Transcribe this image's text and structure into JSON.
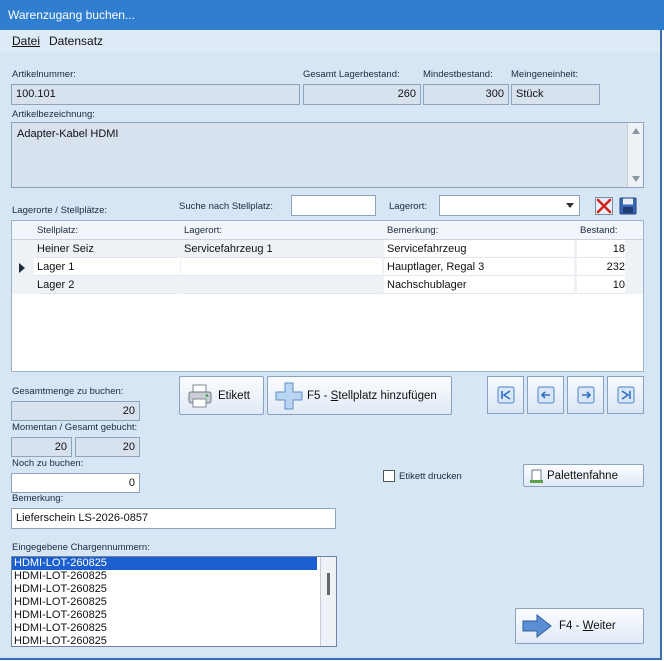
{
  "window": {
    "title": "Warenzugang buchen..."
  },
  "menu": {
    "file": "Datei",
    "record": "Datensatz"
  },
  "article": {
    "number_label": "Artikelnummer:",
    "number": "100.101",
    "total_stock_label": "Gesamt Lagerbestand:",
    "total_stock": "260",
    "min_stock_label": "Mindestbestand:",
    "min_stock": "300",
    "unit_label": "Meingeneinheit:",
    "unit": "Stück",
    "desc_label": "Artikelbezeichnung:",
    "desc": "Adapter-Kabel HDMI"
  },
  "locations": {
    "label": "Lagerorte / Stellplätze:",
    "search_label": "Suche nach Stellplatz:",
    "search_value": "",
    "lagerort_label": "Lagerort:",
    "lagerort_value": "",
    "columns": [
      "Stellplatz:",
      "Lagerort:",
      "Bemerkung:",
      "Bestand:"
    ],
    "rows": [
      {
        "stellplatz": "Heiner Seiz",
        "lagerort": "Servicefahrzeug 1",
        "bemerkung": "Servicefahrzeug",
        "bestand": "18"
      },
      {
        "stellplatz": "Lager 1",
        "lagerort": "",
        "bemerkung": "Hauptlager, Regal 3",
        "bestand": "232"
      },
      {
        "stellplatz": "Lager 2",
        "lagerort": "",
        "bemerkung": "Nachschublager",
        "bestand": "10"
      }
    ],
    "current_row_marker": "▶"
  },
  "booking": {
    "total_label": "Gesamtmenge zu buchen:",
    "total": "20",
    "current_label": "Momentan / Gesamt gebucht:",
    "current": "20",
    "overall": "20",
    "remaining_label": "Noch zu buchen:",
    "remaining": "0",
    "remark_label": "Bemerkung:",
    "remark": "Lieferschein LS-2026-0857",
    "print_label_checkbox": "Etikett drucken",
    "print_label_checked": false
  },
  "buttons": {
    "label_btn": "Etikett",
    "add_slot_prefix": "F5 - ",
    "add_slot_hot": "S",
    "add_slot_rest": "tellplatz hinzufügen",
    "pallet": "Palettenfahne",
    "next_prefix": "F4 - ",
    "next_hot": "W",
    "next_rest": "eiter"
  },
  "batches": {
    "label": "Eingegebene Chargennummern:",
    "items": [
      "HDMI-LOT-260825",
      "HDMI-LOT-260825",
      "HDMI-LOT-260825",
      "HDMI-LOT-260825",
      "HDMI-LOT-260825",
      "HDMI-LOT-260825",
      "HDMI-LOT-260825"
    ]
  },
  "icons": {
    "delete": "delete-icon",
    "save": "save-icon",
    "printer": "printer-icon",
    "add": "add-icon",
    "first": "first-record-icon",
    "prev": "previous-record-icon",
    "next": "next-record-icon",
    "last": "last-record-icon",
    "pallet": "pallet-icon",
    "forward": "forward-arrow-icon"
  },
  "colors": {
    "titlebar": "#2f7ed0",
    "form_bg": "#d6e6f5",
    "selection": "#1c5fd0"
  }
}
